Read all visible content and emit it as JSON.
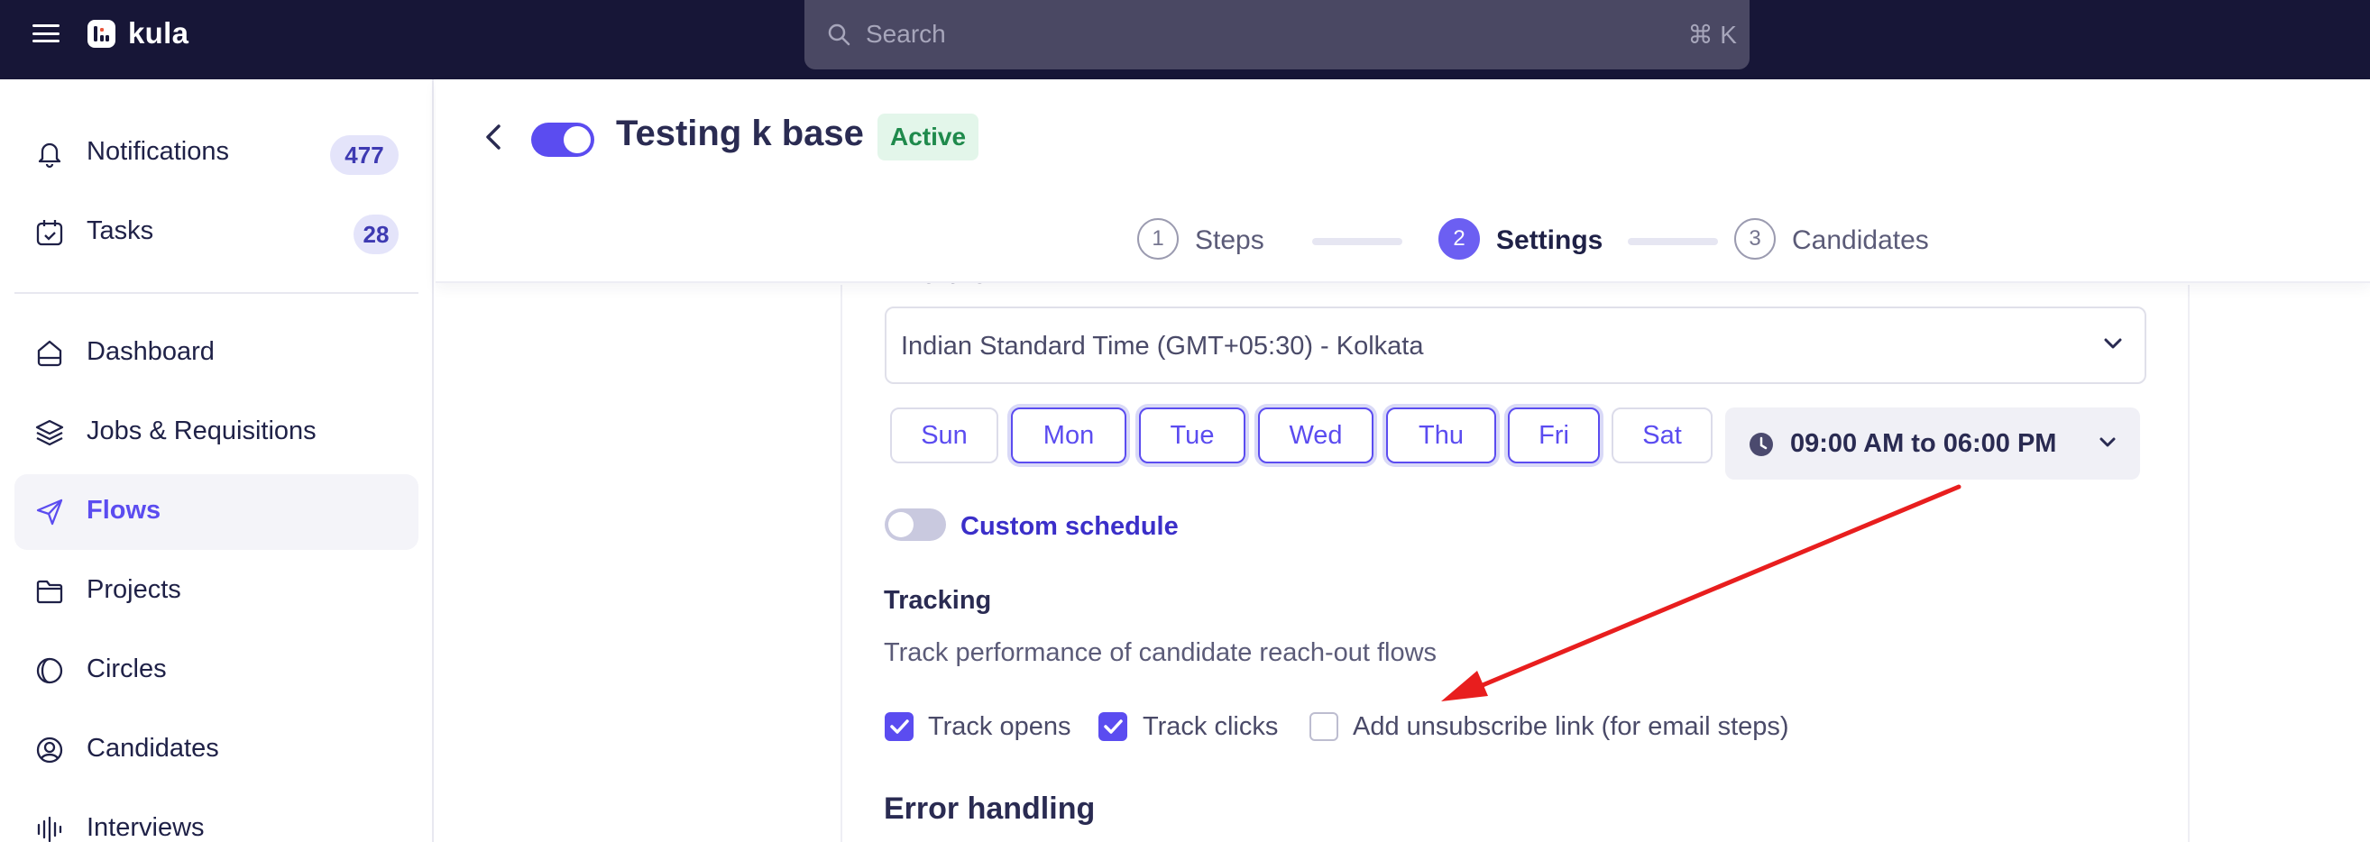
{
  "topbar": {
    "brand": "kula",
    "search_placeholder": "Search",
    "search_shortcut": "⌘ K"
  },
  "sidebar": {
    "items": [
      {
        "label": "Notifications",
        "badge": "477",
        "icon": "bell-icon"
      },
      {
        "label": "Tasks",
        "badge": "28",
        "icon": "calendar-check-icon"
      },
      {
        "label": "Dashboard",
        "icon": "home-icon"
      },
      {
        "label": "Jobs & Requisitions",
        "icon": "layers-icon"
      },
      {
        "label": "Flows",
        "icon": "send-icon",
        "active": true
      },
      {
        "label": "Projects",
        "icon": "folder-icon"
      },
      {
        "label": "Circles",
        "icon": "circles-icon"
      },
      {
        "label": "Candidates",
        "icon": "user-circle-icon"
      },
      {
        "label": "Interviews",
        "icon": "audio-bars-icon"
      }
    ]
  },
  "header": {
    "title": "Testing k base",
    "status": "Active",
    "steps": [
      {
        "num": "1",
        "label": "Steps"
      },
      {
        "num": "2",
        "label": "Settings",
        "active": true
      },
      {
        "num": "3",
        "label": "Candidates"
      }
    ]
  },
  "settings": {
    "timezone_label": "Timezone",
    "timezone_value": "Indian Standard Time (GMT+05:30) - Kolkata",
    "days": [
      {
        "label": "Sun",
        "selected": false
      },
      {
        "label": "Mon",
        "selected": true
      },
      {
        "label": "Tue",
        "selected": true
      },
      {
        "label": "Wed",
        "selected": true
      },
      {
        "label": "Thu",
        "selected": true
      },
      {
        "label": "Fri",
        "selected": true
      },
      {
        "label": "Sat",
        "selected": false
      }
    ],
    "time_range": "09:00 AM to 06:00 PM",
    "custom_schedule_label": "Custom schedule",
    "tracking_title": "Tracking",
    "tracking_desc": "Track performance of candidate reach-out flows",
    "track_opens": "Track opens",
    "track_clicks": "Track clicks",
    "unsubscribe": "Add unsubscribe link (for email steps)",
    "error_title": "Error handling"
  },
  "colors": {
    "topbar": "#171637",
    "accent": "#5b4cf0",
    "annotation_arrow": "#e81e1e"
  }
}
